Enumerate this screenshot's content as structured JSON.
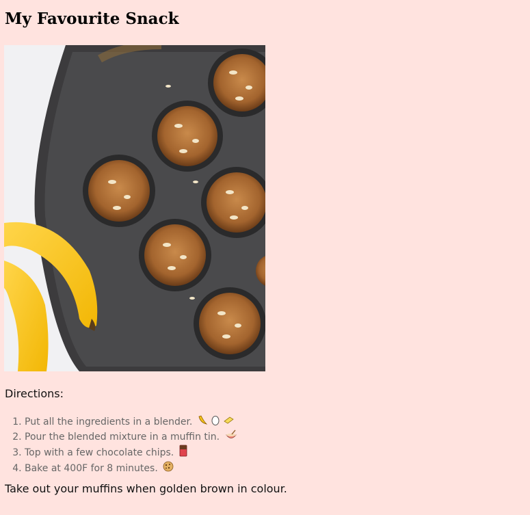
{
  "page": {
    "title": "My Favourite Snack"
  },
  "photo": {
    "subject": "muffins-in-tin-with-bananas"
  },
  "directions": {
    "heading": "Directions:",
    "steps": [
      {
        "text": "Put all the ingredients in a blender.",
        "icons": [
          "banana-icon",
          "egg-icon",
          "butter-icon"
        ]
      },
      {
        "text": "Pour the blended mixture in a muffin tin.",
        "icons": [
          "mixing-bowl-icon"
        ]
      },
      {
        "text": "Top with a few chocolate chips.",
        "icons": [
          "chocolate-bar-icon"
        ]
      },
      {
        "text": "Bake at 400F for 8 minutes.",
        "icons": [
          "cookie-icon"
        ]
      }
    ]
  },
  "closing": "Take out your muffins when golden brown in colour.",
  "colors": {
    "background": "#ffe3df",
    "step_text": "#666666"
  }
}
